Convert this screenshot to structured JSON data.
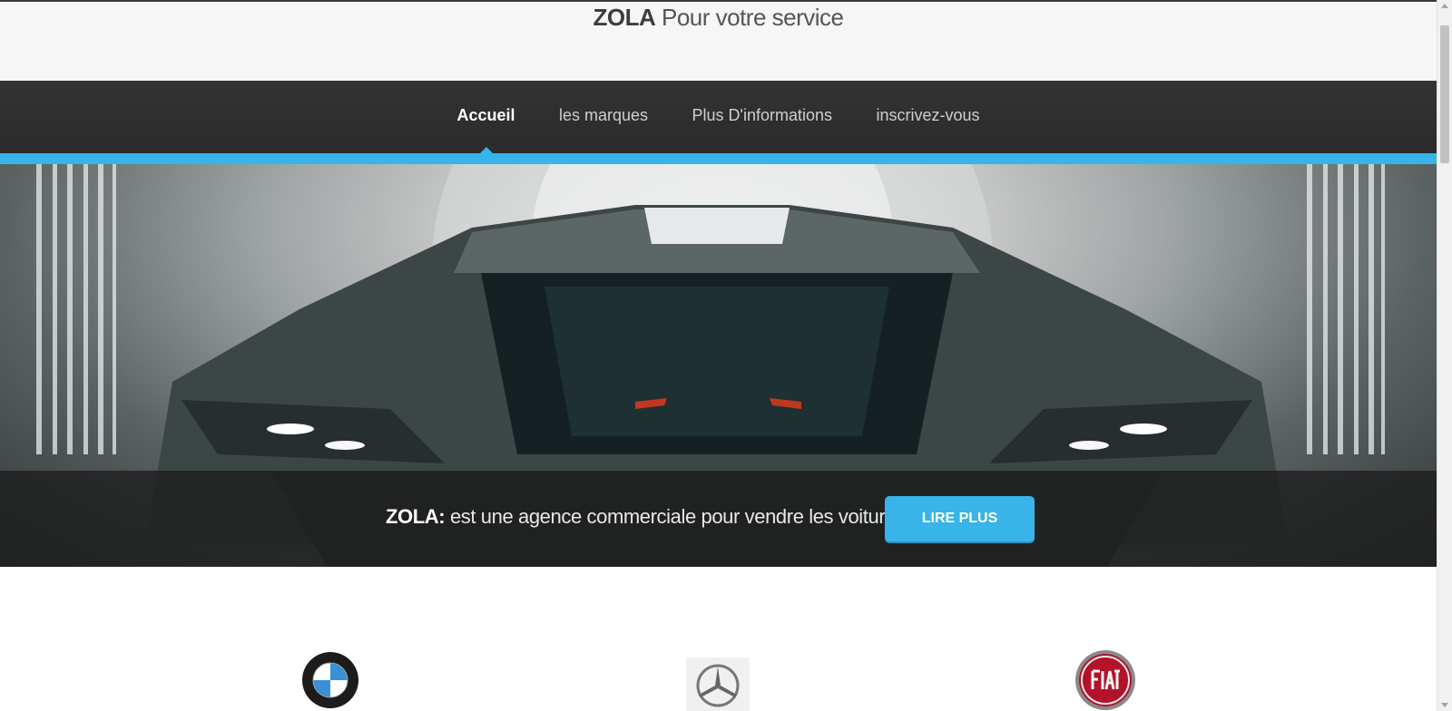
{
  "header": {
    "brand": "ZOLA",
    "tagline": "Pour votre service"
  },
  "nav": {
    "items": [
      {
        "label": "Accueil",
        "active": true
      },
      {
        "label": "les marques",
        "active": false
      },
      {
        "label": "Plus D'informations",
        "active": false
      },
      {
        "label": "inscrivez-vous",
        "active": false
      }
    ]
  },
  "hero": {
    "image": "supercar-front-image",
    "banner_brand": "ZOLA:",
    "banner_text": "est une agence commerciale pour vendre les voitures.",
    "button_label": "LIRE PLUS"
  },
  "brands": {
    "logos": [
      "bmw-logo",
      "mercedes-logo",
      "fiat-logo"
    ]
  },
  "colors": {
    "accent": "#38b4e8",
    "nav_bg": "#2f2f2f",
    "banner_bg": "#1e2020"
  }
}
